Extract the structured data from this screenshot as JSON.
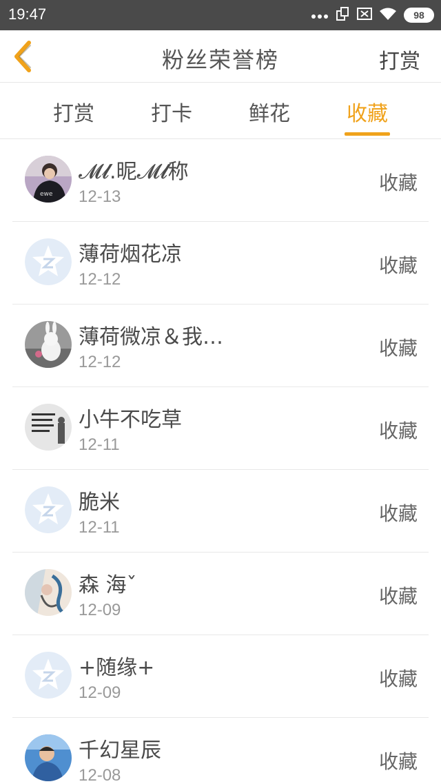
{
  "status_bar": {
    "time": "19:47",
    "battery": "98"
  },
  "header": {
    "title": "粉丝荣誉榜",
    "action_label": "打赏"
  },
  "tabs": [
    {
      "label": "打赏",
      "active": false
    },
    {
      "label": "打卡",
      "active": false
    },
    {
      "label": "鲜花",
      "active": false
    },
    {
      "label": "收藏",
      "active": true
    }
  ],
  "accent_color": "#f0a21b",
  "fans": [
    {
      "name": "𝓜𝓵.昵𝓜𝓵称",
      "date": "12-13",
      "action": "收藏",
      "avatar": "photo-boy"
    },
    {
      "name": "薄荷烟花凉",
      "date": "12-12",
      "action": "收藏",
      "avatar": "default-star"
    },
    {
      "name": "薄荷微凉＆我…",
      "date": "12-12",
      "action": "收藏",
      "avatar": "photo-rabbit"
    },
    {
      "name": "小牛不吃草",
      "date": "12-11",
      "action": "收藏",
      "avatar": "photo-text"
    },
    {
      "name": "脆米",
      "date": "12-11",
      "action": "收藏",
      "avatar": "default-star"
    },
    {
      "name": "森 海ˇ",
      "date": "12-09",
      "action": "收藏",
      "avatar": "photo-art"
    },
    {
      "name": "+随缘+",
      "date": "12-09",
      "action": "收藏",
      "avatar": "default-star"
    },
    {
      "name": "千幻星辰",
      "date": "12-08",
      "action": "收藏",
      "avatar": "photo-child"
    }
  ]
}
